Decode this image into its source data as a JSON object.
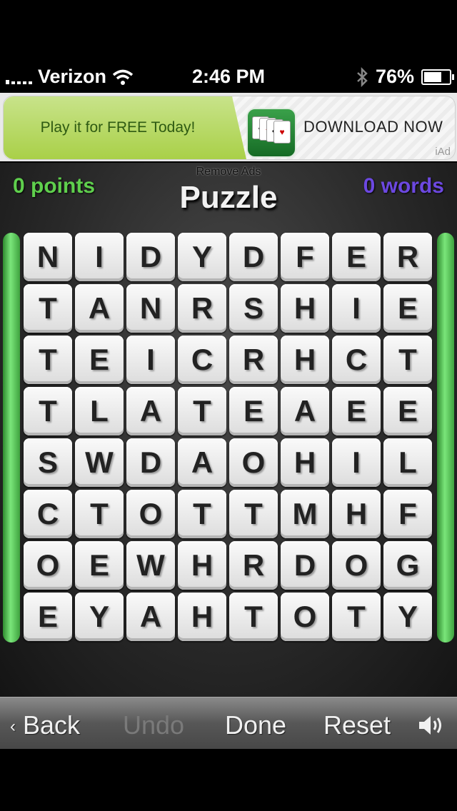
{
  "status": {
    "carrier": "Verizon",
    "time": "2:46 PM",
    "battery": "76%",
    "battery_level": 0.76
  },
  "ad": {
    "headline": "Play it for FREE Today!",
    "cta": "DOWNLOAD NOW",
    "badge": "iAd"
  },
  "game": {
    "remove_ads": "Remove Ads",
    "title": "Puzzle",
    "points": "0 points",
    "words": "0 words",
    "grid": [
      [
        "N",
        "I",
        "D",
        "Y",
        "D",
        "F",
        "E",
        "R"
      ],
      [
        "T",
        "A",
        "N",
        "R",
        "S",
        "H",
        "I",
        "E"
      ],
      [
        "T",
        "E",
        "I",
        "C",
        "R",
        "H",
        "C",
        "T"
      ],
      [
        "T",
        "L",
        "A",
        "T",
        "E",
        "A",
        "E",
        "E"
      ],
      [
        "S",
        "W",
        "D",
        "A",
        "O",
        "H",
        "I",
        "L"
      ],
      [
        "C",
        "T",
        "O",
        "T",
        "T",
        "M",
        "H",
        "F"
      ],
      [
        "O",
        "E",
        "W",
        "H",
        "R",
        "D",
        "O",
        "G"
      ],
      [
        "E",
        "Y",
        "A",
        "H",
        "T",
        "O",
        "T",
        "Y"
      ]
    ]
  },
  "toolbar": {
    "back": "Back",
    "undo": "Undo",
    "done": "Done",
    "reset": "Reset",
    "sound_icon": "speaker-icon"
  },
  "colors": {
    "points": "#5fcf4d",
    "words": "#6c48e0",
    "rail": "#5fd35f"
  }
}
